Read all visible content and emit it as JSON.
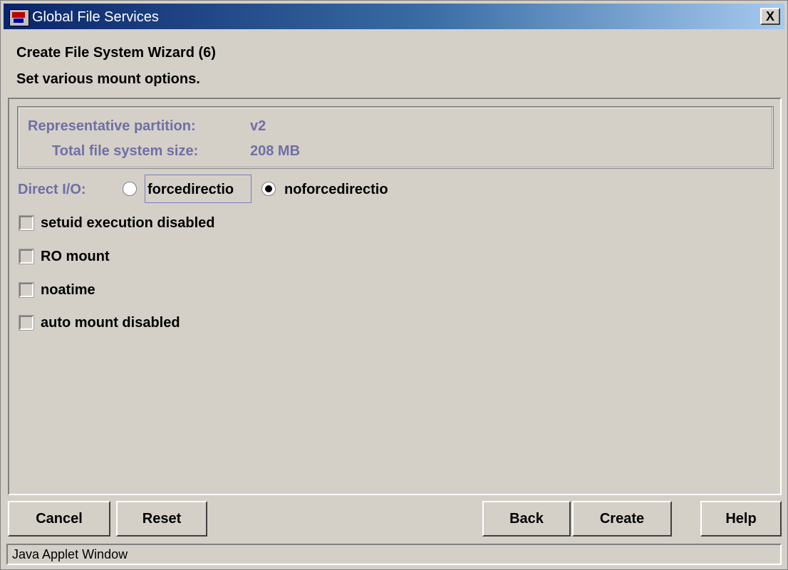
{
  "window": {
    "title": "Global File Services",
    "close_label": "X"
  },
  "header": {
    "wizard_title": "Create File System Wizard (6)",
    "instruction": "Set various mount options."
  },
  "info": {
    "partition_label": "Representative partition:",
    "partition_value": "v2",
    "size_label": "Total file system size:",
    "size_value": "208 MB"
  },
  "direct_io": {
    "label": "Direct I/O:",
    "options": [
      {
        "label": "forcedirectio",
        "selected": false
      },
      {
        "label": "noforcedirectio",
        "selected": true
      }
    ]
  },
  "mount_options": [
    {
      "label": "setuid execution disabled",
      "checked": false
    },
    {
      "label": "RO mount",
      "checked": false
    },
    {
      "label": "noatime",
      "checked": false
    },
    {
      "label": "auto mount disabled",
      "checked": false
    }
  ],
  "buttons": {
    "cancel": "Cancel",
    "reset": "Reset",
    "back": "Back",
    "create": "Create",
    "help": "Help"
  },
  "status": "Java Applet Window",
  "icons": {
    "window_icon": "app-icon",
    "radio_selected": "radio-dot"
  }
}
